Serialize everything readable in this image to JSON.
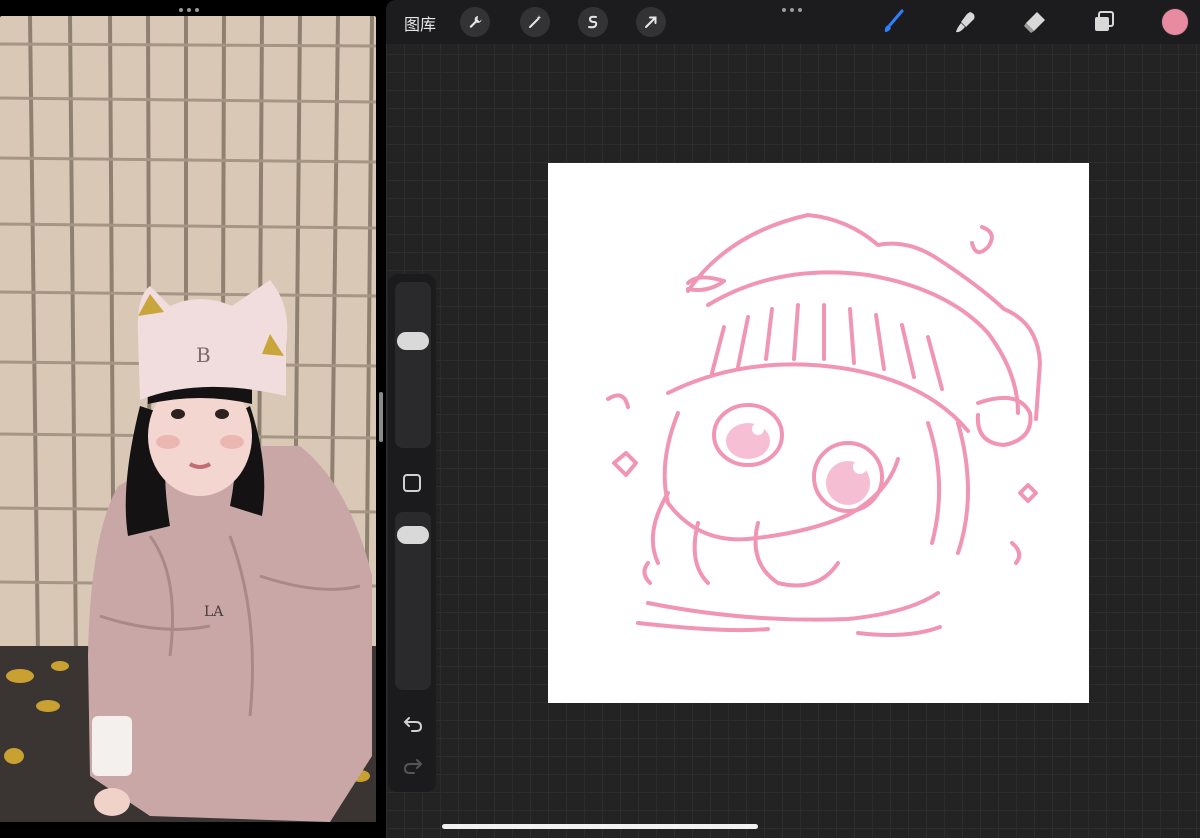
{
  "topbar": {
    "gallery_label": "图库",
    "left_tools": [
      "wrench-icon",
      "magic-wand-icon",
      "selection-icon",
      "transform-arrow-icon"
    ],
    "right_tools": [
      "brush-icon",
      "smudge-icon",
      "eraser-icon",
      "layers-icon"
    ],
    "active_tool": "brush",
    "current_color": "#e88aa0",
    "accent_color": "#2f80ff"
  },
  "sidebar": {
    "brush_size": 0.28,
    "brush_opacity": 0.04
  },
  "canvas": {
    "background": "#ffffff",
    "stroke_color": "#f08aae"
  },
  "reference_photo": {
    "cap_monogram": "B",
    "jacket_logo": "LA"
  }
}
